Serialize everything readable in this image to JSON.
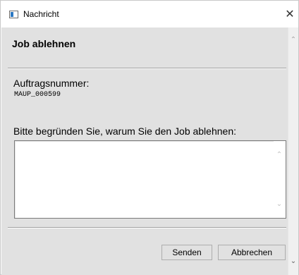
{
  "window": {
    "title": "Nachricht",
    "close_glyph": "✕"
  },
  "dialog": {
    "heading": "Job ablehnen",
    "order_label": "Auftragsnummer:",
    "order_value": "MAUP_000599",
    "reason_label": "Bitte begründen Sie, warum Sie den Job ablehnen:",
    "reason_value": ""
  },
  "buttons": {
    "send_label": "Senden",
    "cancel_label": "Abbrechen"
  },
  "icons": {
    "app": "window-app-icon",
    "close": "close-icon",
    "scroll_up": "chevron-up-icon",
    "scroll_down": "chevron-down-icon"
  },
  "scroll": {
    "up_glyph": "⌃",
    "down_glyph": "⌄"
  }
}
